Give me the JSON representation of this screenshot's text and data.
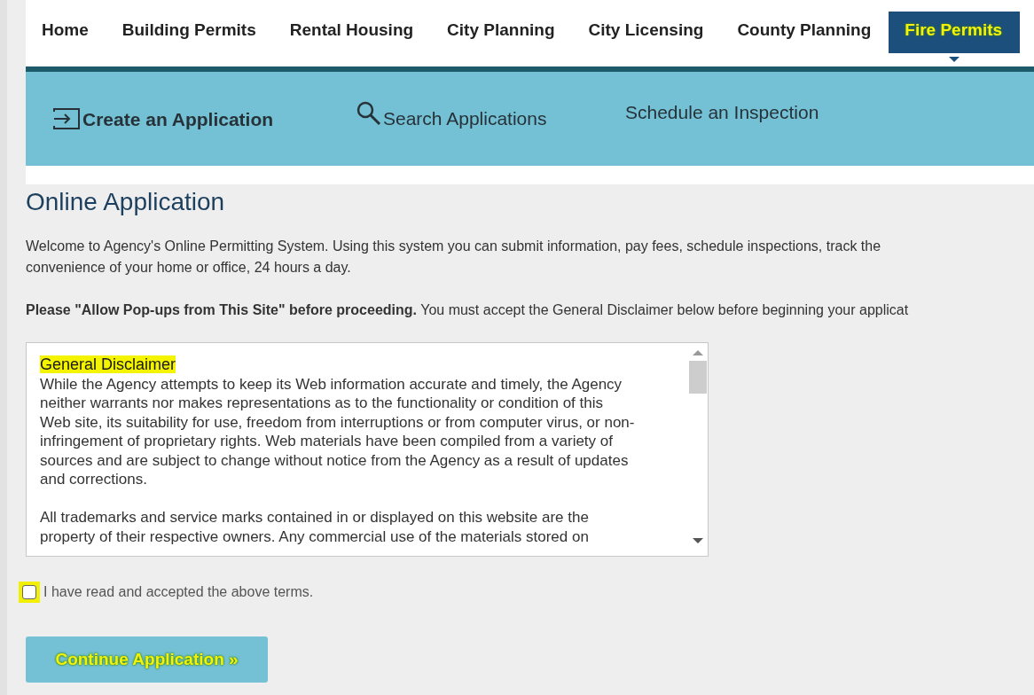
{
  "nav": {
    "tabs": [
      {
        "label": "Home",
        "selected": false,
        "highlighted": false
      },
      {
        "label": "Building Permits",
        "selected": false,
        "highlighted": false
      },
      {
        "label": "Rental Housing",
        "selected": false,
        "highlighted": false
      },
      {
        "label": "City Planning",
        "selected": false,
        "highlighted": false
      },
      {
        "label": "City Licensing",
        "selected": false,
        "highlighted": false
      },
      {
        "label": "County Planning",
        "selected": false,
        "highlighted": false
      },
      {
        "label": "Fire Permits",
        "selected": true,
        "highlighted": true
      }
    ]
  },
  "subnav": {
    "items": [
      {
        "kind": "create",
        "label": "Create an Application"
      },
      {
        "kind": "search",
        "label": "Search Applications"
      },
      {
        "kind": "plain",
        "label": "Schedule an Inspection"
      }
    ]
  },
  "page": {
    "title": "Online Application",
    "intro_lines": [
      "Welcome to Agency's Online Permitting System. Using this system you can submit information, pay fees, schedule inspections, track the",
      "convenience of your home or office, 24 hours a day."
    ],
    "notice": "**Please \"Allow Pop-ups from This Site\" before proceeding.** You must accept the General Disclaimer below before beginning your applicat"
  },
  "disclaimer": {
    "title": "General Disclaimer",
    "title_highlighted": true,
    "paragraphs": [
      "While the Agency attempts to keep its Web information accurate and timely, the Agency neither warrants nor makes representations as to the functionality or condition of this Web site, its suitability for use, freedom from interruptions or from computer virus, or non-infringement of proprietary rights. Web materials have been compiled from a variety of sources and are subject to change without notice from the Agency as a result of updates and corrections.",
      "All trademarks and service marks contained in or displayed on this website are the property of their respective owners. Any commercial use of the materials stored on"
    ]
  },
  "accept": {
    "label": "I have read and accepted the above terms.",
    "checked": false,
    "highlighted": true
  },
  "continue_button": {
    "label": "Continue Application »",
    "highlighted": true
  }
}
